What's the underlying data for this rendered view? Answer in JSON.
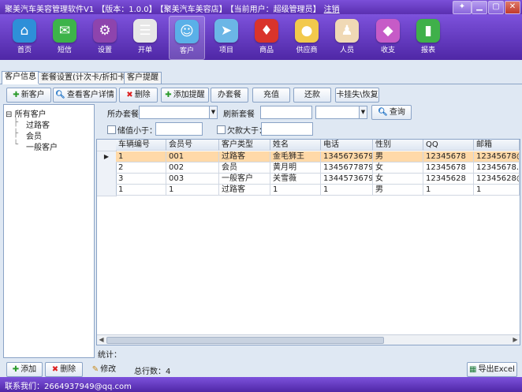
{
  "titlebar": {
    "app": "聚美汽车美容管理软件V1",
    "version": "【版本：1.0.0】",
    "store": "【聚美汽车美容店】",
    "user": "【当前用户：超级管理员】",
    "logout": "注销"
  },
  "toolbar": [
    {
      "label": "首页",
      "icon": "home-icon",
      "color": "#2e8fd8",
      "glyph": "⌂"
    },
    {
      "label": "短信",
      "icon": "message-icon",
      "color": "#3db34a",
      "glyph": "✉"
    },
    {
      "label": "设置",
      "icon": "gear-icon",
      "color": "#8e44ad",
      "glyph": "⚙"
    },
    {
      "label": "开单",
      "icon": "order-icon",
      "color": "#e7e7e7",
      "glyph": "☰"
    },
    {
      "label": "客户",
      "icon": "user-icon",
      "color": "#5ab0e8",
      "glyph": "☺"
    },
    {
      "label": "项目",
      "icon": "send-icon",
      "color": "#6bb6e6",
      "glyph": "➤"
    },
    {
      "label": "商品",
      "icon": "goods-icon",
      "color": "#d9342b",
      "glyph": "♦"
    },
    {
      "label": "供应商",
      "icon": "supplier-icon",
      "color": "#f2c94c",
      "glyph": "●"
    },
    {
      "label": "人员",
      "icon": "staff-icon",
      "color": "#f0d9b5",
      "glyph": "♟"
    },
    {
      "label": "收支",
      "icon": "finance-icon",
      "color": "#c65bc7",
      "glyph": "◆"
    },
    {
      "label": "报表",
      "icon": "report-icon",
      "color": "#3fb04a",
      "glyph": "▮"
    }
  ],
  "tabs": [
    "客户信息",
    "套餐设置(计次卡/折扣卡)",
    "客户提醒"
  ],
  "buttons": {
    "new_customer": "新客户",
    "view_detail": "查看客户详情",
    "delete": "删除",
    "add_reminder": "添加提醒",
    "package": "办套餐",
    "recharge": "充值",
    "repay": "还款",
    "card_loss": "卡挂失\\恢复",
    "query": "查询",
    "add": "添加",
    "delete2": "删除",
    "edit": "修改",
    "export": "导出Excel"
  },
  "tree": {
    "root": "所有客户",
    "children": [
      "过路客",
      "会员",
      "一般客户"
    ]
  },
  "filters": {
    "package_label": "所办套餐",
    "refresh_label": "刷新套餐",
    "balance_label": "储值小于：",
    "debt_label": "欠款大于："
  },
  "grid": {
    "columns": [
      "车辆编号",
      "会员号",
      "客户类型",
      "姓名",
      "电话",
      "性别",
      "QQ",
      "邮箱"
    ],
    "rows": [
      [
        "1",
        "001",
        "过路客",
        "金毛狮王",
        "1345673679",
        "男",
        "12345678",
        "12345678@"
      ],
      [
        "2",
        "002",
        "会员",
        "黄月明",
        "1345677879",
        "女",
        "12345678",
        "12345678..."
      ],
      [
        "3",
        "003",
        "一般客户",
        "关雪薇",
        "1344573679",
        "女",
        "12345628",
        "12345628@"
      ],
      [
        "1",
        "1",
        "过路客",
        "1",
        "1",
        "男",
        "1",
        "1"
      ]
    ]
  },
  "footer": {
    "stats_label": "统计：",
    "total": "总行数：4",
    "contact": "联系我们：2664937949@qq.com"
  }
}
